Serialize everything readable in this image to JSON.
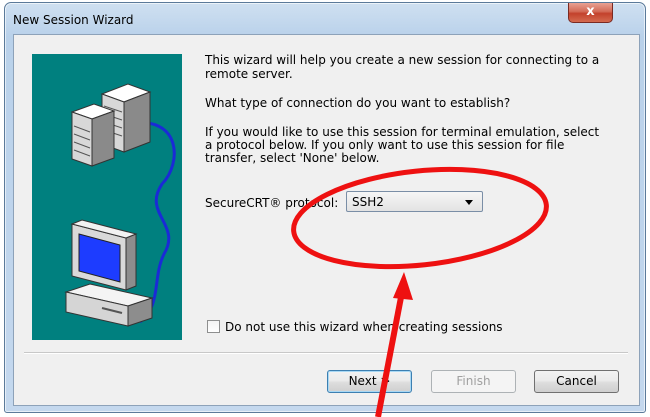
{
  "window": {
    "title": "New Session Wizard",
    "close_glyph": "x"
  },
  "intro": {
    "line1": "This wizard will help you create a new session for connecting to a",
    "line2": "remote server."
  },
  "question": "What type of connection do you want to establish?",
  "instructions": {
    "line1": "If you would like to use this session for terminal emulation, select",
    "line2": "a protocol below.  If you only want to use this session for file",
    "line3": "transfer, select 'None' below."
  },
  "protocol": {
    "label": "SecureCRT® protocol:",
    "selected": "SSH2"
  },
  "dont_use_wizard": {
    "checked": false,
    "label": "Do not use this wizard when creating sessions"
  },
  "buttons": {
    "next": "Next >",
    "finish": "Finish",
    "cancel": "Cancel"
  },
  "annotation": {
    "color": "#ee1111"
  }
}
